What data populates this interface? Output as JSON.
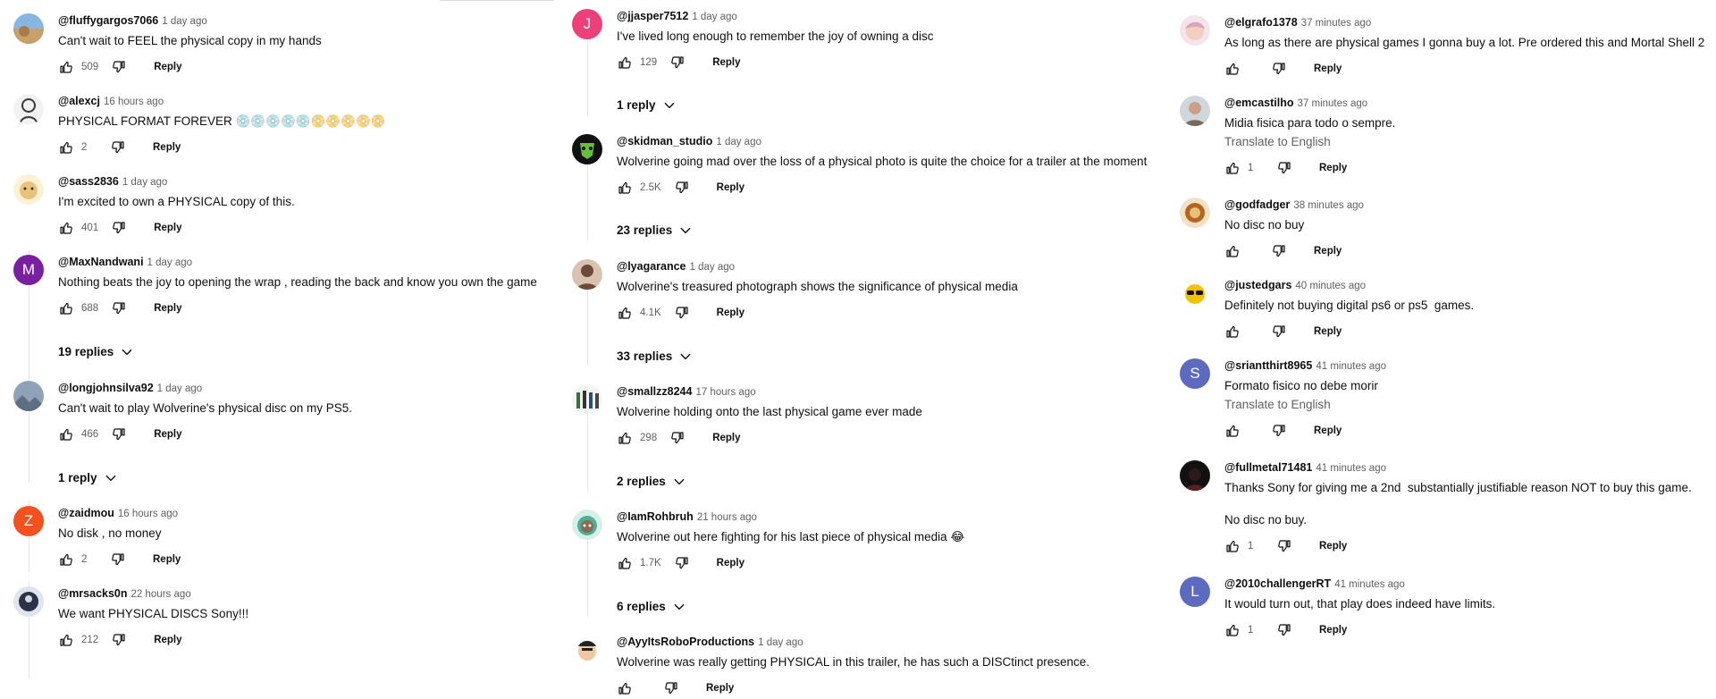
{
  "common": {
    "reply_label": "Reply"
  },
  "columns": [
    {
      "comments": [
        {
          "author": "@fluffygargos7066",
          "time": "1 day ago",
          "text": "Can't wait to FEEL the physical copy in my hands",
          "likes": "509",
          "avatar": {
            "icon": "desert-photo-avatar-icon",
            "color": "#c9a06a"
          }
        },
        {
          "author": "@alexcj",
          "time": "16 hours ago",
          "text": "PHYSICAL FORMAT FOREVER 💿💿💿💿💿📀📀📀📀📀",
          "likes": "2",
          "avatar": {
            "icon": "sketch-portrait-avatar-icon",
            "color": "#3a3a3a"
          }
        },
        {
          "author": "@sass2836",
          "time": "1 day ago",
          "text": "I'm excited to own a PHYSICAL copy of this.",
          "likes": "401",
          "avatar": {
            "icon": "cartoon-avatar-icon",
            "color": "#e8c27a"
          }
        },
        {
          "author": "@MaxNandwani",
          "time": "1 day ago",
          "text": "Nothing beats the joy to opening the wrap , reading the back and know you own the game",
          "likes": "688",
          "avatar": {
            "letter": "M",
            "color": "#7b1fa2"
          },
          "replies": "19 replies"
        },
        {
          "author": "@longjohnsilva92",
          "time": "1 day ago",
          "text": "Can't wait to play Wolverine's physical disc on my PS5.",
          "likes": "466",
          "avatar": {
            "icon": "landscape-avatar-icon",
            "color": "#8fa3b8"
          },
          "replies": "1 reply"
        },
        {
          "author": "@zaidmou",
          "time": "16 hours ago",
          "text": "No disk , no money",
          "likes": "2",
          "avatar": {
            "letter": "Z",
            "color": "#f4511e"
          }
        },
        {
          "author": "@mrsacks0n",
          "time": "22 hours ago",
          "text": "We want PHYSICAL DISCS Sony!!!",
          "likes": "212",
          "avatar": {
            "icon": "dark-character-avatar-icon",
            "color": "#2c3346"
          }
        }
      ]
    },
    {
      "comments": [
        {
          "author": "@jjasper7512",
          "time": "1 day ago",
          "text": "I've lived long enough to remember the joy of owning a disc",
          "likes": "129",
          "avatar": {
            "letter": "J",
            "color": "#ec407a"
          },
          "replies": "1 reply"
        },
        {
          "author": "@skidman_studio",
          "time": "1 day ago",
          "text": "Wolverine going mad over the loss of a physical photo is quite the choice for a trailer at the moment",
          "likes": "2.5K",
          "avatar": {
            "icon": "green-mask-avatar-icon",
            "color": "#111111"
          },
          "replies": "23 replies"
        },
        {
          "author": "@lyagarance",
          "time": "1 day ago",
          "text": "Wolverine's treasured photograph shows the significance of physical media",
          "likes": "4.1K",
          "avatar": {
            "icon": "portrait-photo-avatar-icon",
            "color": "#6b4a3a"
          },
          "replies": "33 replies"
        },
        {
          "author": "@smallzz8244",
          "time": "17 hours ago",
          "text": "Wolverine holding onto the last physical game ever made",
          "likes": "298",
          "avatar": {
            "icon": "group-figures-avatar-icon",
            "color": "#f5f5f5"
          },
          "replies": "2 replies"
        },
        {
          "author": "@IamRohbruh",
          "time": "21 hours ago",
          "text": "Wolverine out here fighting for his last piece of physical media 😂",
          "likes": "1.7K",
          "avatar": {
            "icon": "sloth-avatar-icon",
            "color": "#4caf9a"
          },
          "replies": "6 replies"
        },
        {
          "author": "@AyyItsRoboProductions",
          "time": "1 day ago",
          "text": "Wolverine was really getting PHYSICAL in this trailer, he has such a DISCtinct presence.",
          "likes": "",
          "avatar": {
            "icon": "robot-face-avatar-icon",
            "color": "#f0c7a0"
          }
        }
      ]
    },
    {
      "comments": [
        {
          "author": "@elgrafo1378",
          "time": "37 minutes ago",
          "text": "As long as there are physical games I gonna buy a lot. Pre ordered this and Mortal Shell 2",
          "likes": "",
          "avatar": {
            "icon": "anime-avatar-icon",
            "color": "#d9a7b9"
          }
        },
        {
          "author": "@emcastilho",
          "time": "37 minutes ago",
          "text": "Midia fisica para todo o sempre.",
          "translate": "Translate to English",
          "likes": "1",
          "avatar": {
            "icon": "man-photo-avatar-icon",
            "color": "#7a6a5a"
          }
        },
        {
          "author": "@godfadger",
          "time": "38 minutes ago",
          "text": "No disc no buy",
          "likes": "",
          "avatar": {
            "icon": "food-bowl-avatar-icon",
            "color": "#b5651d"
          }
        },
        {
          "author": "@justedgars",
          "time": "40 minutes ago",
          "text": "Definitely not buying digital ps6 or ps5  games.",
          "likes": "",
          "avatar": {
            "icon": "sunglasses-avatar-icon",
            "color": "#f2c200"
          }
        },
        {
          "author": "@sriantthirt8965",
          "time": "41 minutes ago",
          "text": "Formato fisico no debe morir",
          "translate": "Translate to English",
          "likes": "",
          "avatar": {
            "letter": "S",
            "color": "#5c6bc0"
          }
        },
        {
          "author": "@fullmetal71481",
          "time": "41 minutes ago",
          "text": "Thanks Sony for giving me a 2nd  substantially justifiable reason NOT to buy this game.\n\nNo disc no buy.",
          "likes": "1",
          "avatar": {
            "icon": "dark-silhouette-avatar-icon",
            "color": "#2a1a1a"
          }
        },
        {
          "author": "@2010challengerRT",
          "time": "41 minutes ago",
          "text": "It would turn out, that play does indeed have limits.",
          "likes": "1",
          "avatar": {
            "letter": "L",
            "color": "#5c6bc0"
          }
        }
      ]
    }
  ]
}
